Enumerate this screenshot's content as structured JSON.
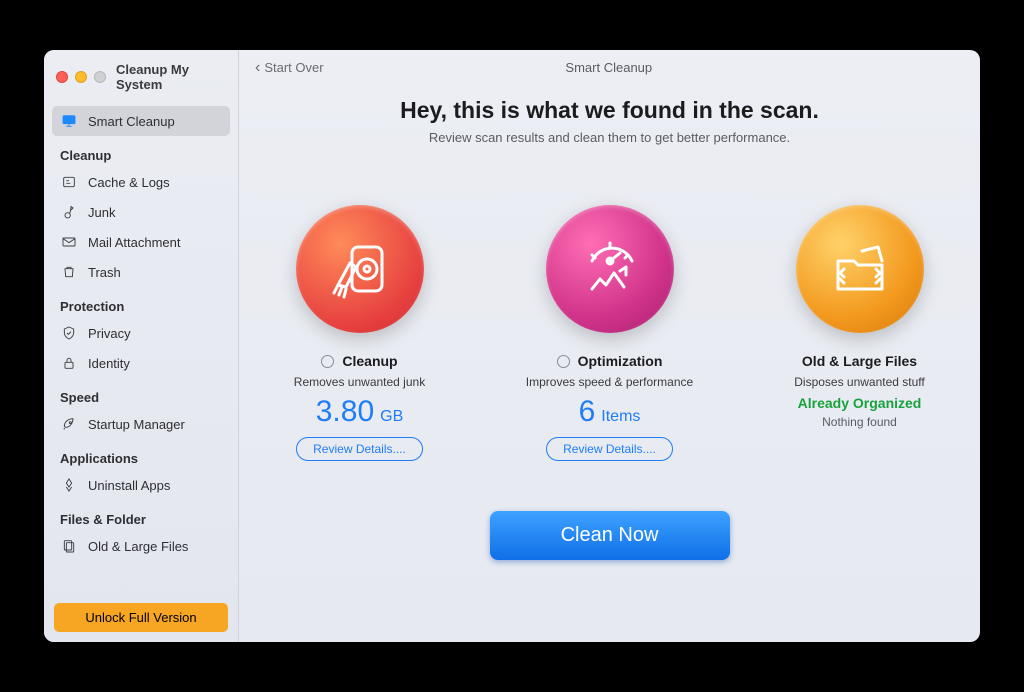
{
  "window": {
    "title": "Cleanup My System"
  },
  "topbar": {
    "back": "Start Over",
    "title": "Smart Cleanup"
  },
  "hero": {
    "headline": "Hey, this is what we found in the scan.",
    "subline": "Review scan results and clean them to get better performance."
  },
  "sidebar": {
    "smartCleanup": "Smart Cleanup",
    "groups": [
      {
        "label": "Cleanup",
        "items": [
          {
            "label": "Cache & Logs",
            "icon": "log-icon"
          },
          {
            "label": "Junk",
            "icon": "junk-icon"
          },
          {
            "label": "Mail Attachment",
            "icon": "mail-icon"
          },
          {
            "label": "Trash",
            "icon": "trash-icon"
          }
        ]
      },
      {
        "label": "Protection",
        "items": [
          {
            "label": "Privacy",
            "icon": "shield-icon"
          },
          {
            "label": "Identity",
            "icon": "lock-icon"
          }
        ]
      },
      {
        "label": "Speed",
        "items": [
          {
            "label": "Startup Manager",
            "icon": "rocket-icon"
          }
        ]
      },
      {
        "label": "Applications",
        "items": [
          {
            "label": "Uninstall Apps",
            "icon": "uninstall-icon"
          }
        ]
      },
      {
        "label": "Files & Folder",
        "items": [
          {
            "label": "Old & Large Files",
            "icon": "files-icon"
          }
        ]
      }
    ],
    "unlock": "Unlock Full Version"
  },
  "cards": {
    "cleanup": {
      "title": "Cleanup",
      "sub": "Removes unwanted junk",
      "value": "3.80",
      "unit": "GB",
      "review": "Review Details...."
    },
    "optimization": {
      "title": "Optimization",
      "sub": "Improves speed & performance",
      "value": "6",
      "unit": "Items",
      "review": "Review Details...."
    },
    "oldlarge": {
      "title": "Old & Large Files",
      "sub": "Disposes unwanted stuff",
      "status": "Already Organized",
      "nothing": "Nothing found"
    }
  },
  "cta": {
    "cleanNow": "Clean Now"
  }
}
